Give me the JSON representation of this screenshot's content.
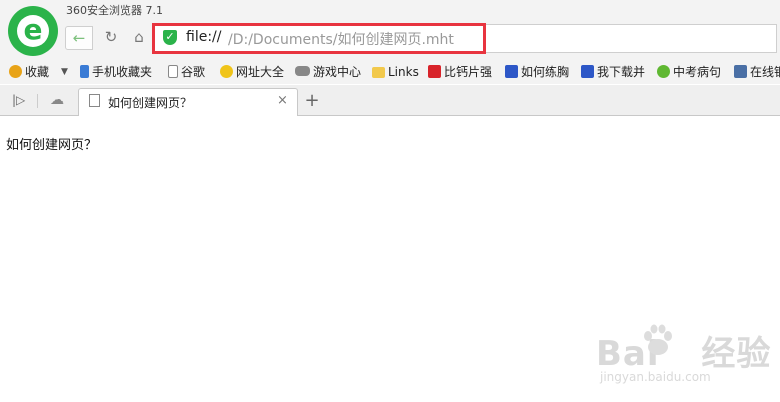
{
  "window": {
    "title": "360安全浏览器 7.1"
  },
  "nav": {
    "back": "←",
    "refresh": "↻",
    "home": "⌂"
  },
  "address_bar": {
    "scheme": "file://",
    "path": "/D:/Documents/如何创建网页.mht",
    "secure_icon": "shield-check-icon"
  },
  "bookmarks": [
    {
      "label": "收藏",
      "icon": "star-add-icon",
      "color": "#e8a317"
    },
    {
      "label": "手机收藏夹",
      "icon": "phone-icon",
      "color": "#3a7bd5"
    },
    {
      "label": "谷歌",
      "icon": "page-icon",
      "color": "#ffffff"
    },
    {
      "label": "网址大全",
      "icon": "plus-circle-icon",
      "color": "#f0c419"
    },
    {
      "label": "游戏中心",
      "icon": "gamepad-icon",
      "color": "#888888"
    },
    {
      "label": "Links",
      "icon": "folder-icon",
      "color": "#f2c94c"
    },
    {
      "label": "比钙片强",
      "icon": "toutiao-icon",
      "color": "#d8232a"
    },
    {
      "label": "如何练胸",
      "icon": "baidu-paw-icon",
      "color": "#2d57c7"
    },
    {
      "label": "我下载并",
      "icon": "baidu-paw-icon",
      "color": "#2d57c7"
    },
    {
      "label": "中考病句",
      "icon": "leaf-icon",
      "color": "#5fb832"
    },
    {
      "label": "在线钢",
      "icon": "monitor-icon",
      "color": "#4a6fa5"
    }
  ],
  "tabs": {
    "active": {
      "title": "如何创建网页？",
      "close": "×"
    },
    "new_tab": "+"
  },
  "page": {
    "text": "如何创建网页？"
  },
  "watermark": {
    "brand": "Bai",
    "brand_cn": "经验",
    "url": "jingyan.baidu.com"
  }
}
